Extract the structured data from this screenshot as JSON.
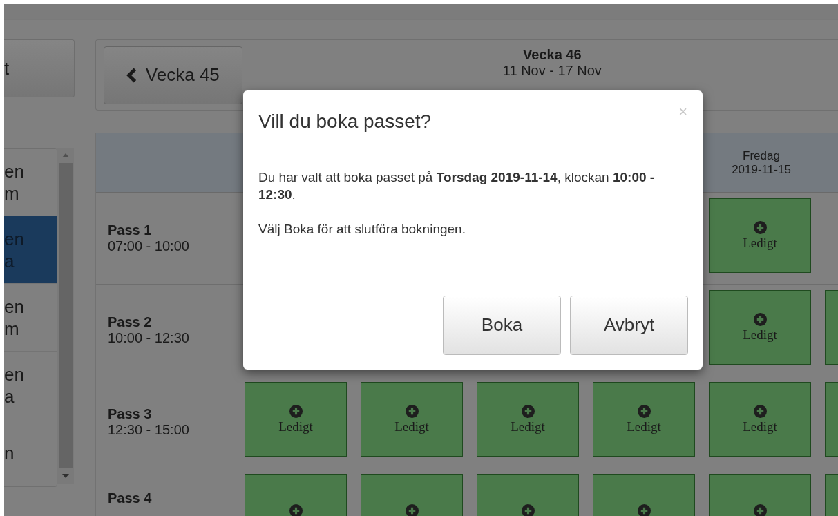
{
  "sidebar": {
    "top_button": {
      "label": "t"
    },
    "items": [
      {
        "lines": [
          "en",
          "m"
        ],
        "selected": false
      },
      {
        "lines": [
          "en",
          "a"
        ],
        "selected": true
      },
      {
        "lines": [
          "en",
          "m"
        ],
        "selected": false
      },
      {
        "lines": [
          "en",
          "a"
        ],
        "selected": false
      },
      {
        "lines": [
          "n"
        ],
        "selected": false
      }
    ]
  },
  "week_nav": {
    "prev_button": "Vecka 45",
    "title": "Vecka 46",
    "range": "11 Nov - 17 Nov"
  },
  "schedule": {
    "columns": [
      {
        "kind": "covered"
      },
      {
        "kind": "covered"
      },
      {
        "kind": "covered"
      },
      {
        "kind": "covered"
      },
      {
        "kind": "day",
        "day": "Fredag",
        "date": "2019-11-15"
      },
      {
        "kind": "covered"
      }
    ],
    "rows": [
      {
        "name": "Pass 1",
        "time": "07:00 - 10:00",
        "cells": [
          {
            "kind": "covered"
          },
          {
            "kind": "covered"
          },
          {
            "kind": "covered"
          },
          {
            "kind": "covered"
          },
          {
            "kind": "free",
            "label": "Ledigt"
          },
          {
            "kind": "covered"
          }
        ]
      },
      {
        "name": "Pass 2",
        "time": "10:00 - 12:30",
        "cells": [
          {
            "kind": "covered"
          },
          {
            "kind": "covered"
          },
          {
            "kind": "covered"
          },
          {
            "kind": "covered"
          },
          {
            "kind": "free",
            "label": "Ledigt"
          },
          {
            "kind": "free"
          }
        ]
      },
      {
        "name": "Pass 3",
        "time": "12:30 - 15:00",
        "cells": [
          {
            "kind": "free",
            "label": "Ledigt"
          },
          {
            "kind": "free",
            "label": "Ledigt"
          },
          {
            "kind": "free",
            "label": "Ledigt"
          },
          {
            "kind": "free",
            "label": "Ledigt"
          },
          {
            "kind": "free",
            "label": "Ledigt"
          },
          {
            "kind": "free"
          }
        ]
      },
      {
        "name": "Pass 4",
        "cells": [
          {
            "kind": "free"
          },
          {
            "kind": "free"
          },
          {
            "kind": "free"
          },
          {
            "kind": "free"
          },
          {
            "kind": "free"
          },
          {
            "kind": "free"
          }
        ]
      }
    ]
  },
  "dialog": {
    "title": "Vill du boka passet?",
    "close": "×",
    "message": "Du har valt att boka passet på **Torsdag 2019-11-14**, klockan **10:00 - 12:30**.",
    "instruction": "Välj Boka för att slutföra bokningen.",
    "buttons": [
      "Boka",
      "Avbryt"
    ]
  }
}
